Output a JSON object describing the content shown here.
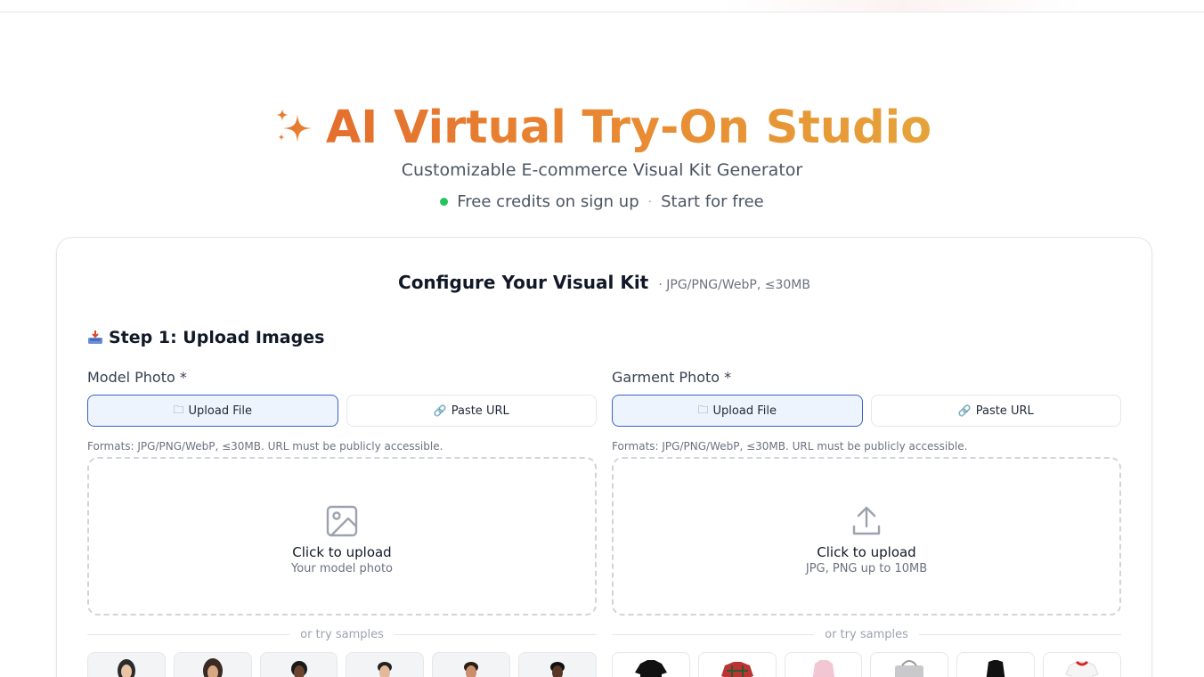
{
  "hero": {
    "title": "AI Virtual Try-On Studio",
    "subtitle": "Customizable E-commerce Visual Kit Generator",
    "credits": "Free credits on sign up",
    "separator": "·",
    "start": "Start for free",
    "accent_colors": [
      "#e46f2e",
      "#e5a33b"
    ]
  },
  "card": {
    "heading": "Configure Your Visual Kit",
    "formats": "· JPG/PNG/WebP, ≤30MB",
    "step_title": "Step 1: Upload Images",
    "step_icon": "inbox-tray-icon"
  },
  "model": {
    "label": "Model Photo *",
    "upload_tab": "Upload File",
    "url_tab": "Paste URL",
    "hint": "Formats: JPG/PNG/WebP, ≤30MB. URL must be publicly accessible.",
    "drop_title": "Click to upload",
    "drop_sub": "Your model photo",
    "drop_icon": "image-icon",
    "samples_label": "or try samples"
  },
  "garment": {
    "label": "Garment Photo *",
    "upload_tab": "Upload File",
    "url_tab": "Paste URL",
    "hint": "Formats: JPG/PNG/WebP, ≤30MB. URL must be publicly accessible.",
    "drop_title": "Click to upload",
    "drop_sub": "JPG, PNG up to 10MB",
    "drop_icon": "upload-icon",
    "samples_label": "or try samples"
  }
}
